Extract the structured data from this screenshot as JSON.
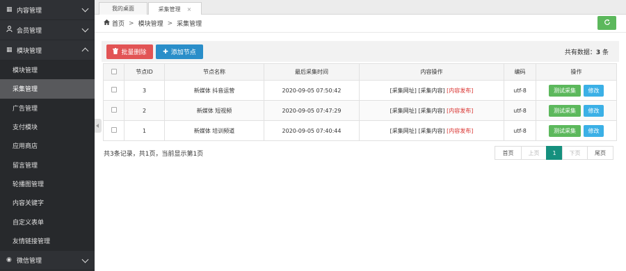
{
  "sidebar": {
    "groups": [
      {
        "label": "内容管理",
        "icon": "grid-icon"
      },
      {
        "label": "会员管理",
        "icon": "user-icon"
      },
      {
        "label": "模块管理",
        "icon": "grid-icon"
      }
    ],
    "items": [
      {
        "label": "模块管理"
      },
      {
        "label": "采集管理"
      },
      {
        "label": "广告管理"
      },
      {
        "label": "支付模块"
      },
      {
        "label": "应用商店"
      },
      {
        "label": "留言管理"
      },
      {
        "label": "轮播图管理"
      },
      {
        "label": "内容关键字"
      },
      {
        "label": "自定义表单"
      },
      {
        "label": "友情链接管理"
      }
    ],
    "bottom_group": {
      "label": "微信管理"
    }
  },
  "tabs": [
    {
      "label": "我的桌面"
    },
    {
      "label": "采集管理",
      "close": "×"
    }
  ],
  "breadcrumb": {
    "home": "首页",
    "sep": ">",
    "level1": "模块管理",
    "level2": "采集管理"
  },
  "toolbar": {
    "batch_delete": "批量删除",
    "add_node": "添加节点",
    "total_prefix": "共有数据：",
    "total_count": "3",
    "total_suffix": "条"
  },
  "table": {
    "headers": [
      "节点ID",
      "节点名称",
      "最后采集时间",
      "内容操作",
      "编码",
      "操作"
    ],
    "rows": [
      {
        "id": "3",
        "name": "新媒体 抖音运营",
        "time": "2020-09-05 07:50:42",
        "op1": "[采集网址]",
        "op2": "[采集内容]",
        "op3": "[内容发布]",
        "encoding": "utf-8",
        "test": "测试采集",
        "edit": "修改"
      },
      {
        "id": "2",
        "name": "新媒体 短视频",
        "time": "2020-09-05 07:47:29",
        "op1": "[采集网址]",
        "op2": "[采集内容]",
        "op3": "[内容发布]",
        "encoding": "utf-8",
        "test": "测试采集",
        "edit": "修改"
      },
      {
        "id": "1",
        "name": "新媒体 培训频道",
        "time": "2020-09-05 07:40:44",
        "op1": "[采集网址]",
        "op2": "[采集内容]",
        "op3": "[内容发布]",
        "encoding": "utf-8",
        "test": "测试采集",
        "edit": "修改"
      }
    ]
  },
  "footer": {
    "record_info": "共3条记录，共1页，当前显示第1页"
  },
  "pager": {
    "first": "首页",
    "prev": "上页",
    "current": "1",
    "next": "下页",
    "last": "尾页"
  },
  "colors": {
    "sidebar_bg": "#2f3135",
    "danger": "#e25455",
    "primary": "#2a8ec9",
    "success": "#5cb85c",
    "info": "#3bb0e6",
    "pager_active": "#15907e"
  }
}
